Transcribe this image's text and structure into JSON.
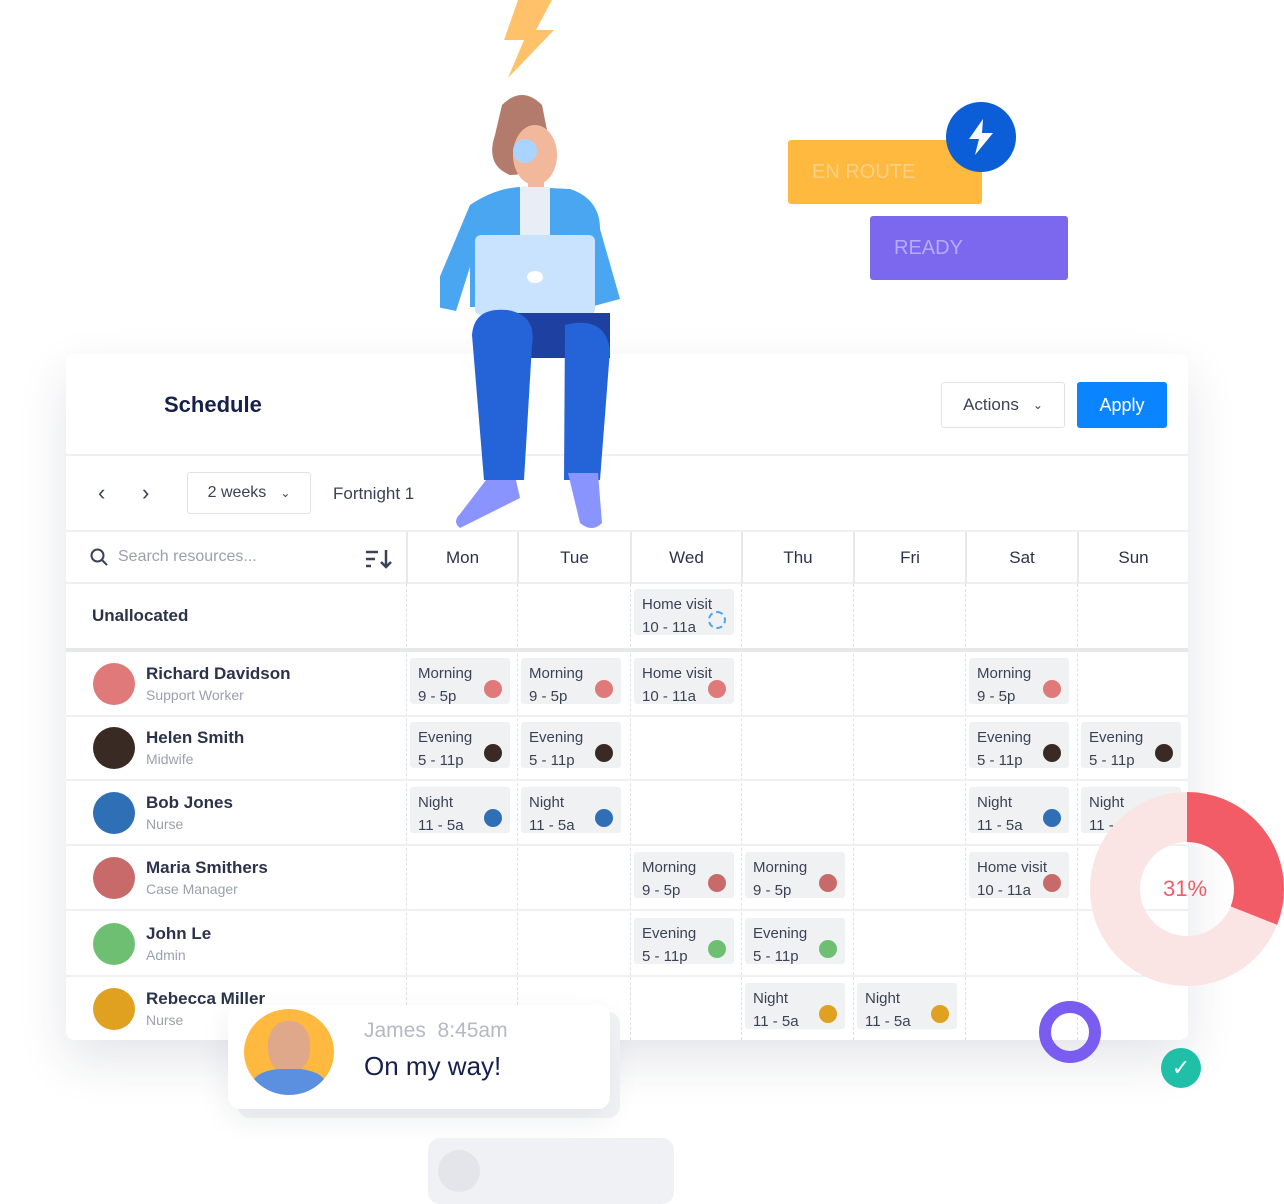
{
  "badges": {
    "en_route": "EN ROUTE",
    "ready": "READY",
    "en_route_color": "#ffb93e",
    "ready_color": "#7b68ee",
    "bolt_color": "#0b5ed7"
  },
  "header": {
    "title": "Schedule",
    "actions_label": "Actions",
    "apply_label": "Apply"
  },
  "toolbar": {
    "range": "2 weeks",
    "period": "Fortnight 1"
  },
  "search": {
    "placeholder": "Search resources..."
  },
  "days": [
    "Mon",
    "Tue",
    "Wed",
    "Thu",
    "Fri",
    "Sat",
    "Sun"
  ],
  "unallocated": {
    "label": "Unallocated",
    "shifts": [
      {
        "day": 2,
        "name": "Home visit",
        "time": "10 - 11a"
      }
    ]
  },
  "resources": [
    {
      "name": "Richard Davidson",
      "role": "Support Worker",
      "color": "#e07a7a",
      "shifts": [
        {
          "day": 0,
          "name": "Morning",
          "time": "9 - 5p"
        },
        {
          "day": 1,
          "name": "Morning",
          "time": "9 - 5p"
        },
        {
          "day": 2,
          "name": "Home visit",
          "time": "10 - 11a"
        },
        {
          "day": 5,
          "name": "Morning",
          "time": "9 - 5p"
        }
      ]
    },
    {
      "name": "Helen Smith",
      "role": "Midwife",
      "color": "#3a2a24",
      "shifts": [
        {
          "day": 0,
          "name": "Evening",
          "time": "5 - 11p"
        },
        {
          "day": 1,
          "name": "Evening",
          "time": "5 - 11p"
        },
        {
          "day": 5,
          "name": "Evening",
          "time": "5 - 11p"
        },
        {
          "day": 6,
          "name": "Evening",
          "time": "5 - 11p"
        }
      ]
    },
    {
      "name": "Bob Jones",
      "role": "Nurse",
      "color": "#2f6fb5",
      "shifts": [
        {
          "day": 0,
          "name": "Night",
          "time": "11 - 5a"
        },
        {
          "day": 1,
          "name": "Night",
          "time": "11 - 5a"
        },
        {
          "day": 5,
          "name": "Night",
          "time": "11 - 5a"
        },
        {
          "day": 6,
          "name": "Night",
          "time": "11 - 5a"
        }
      ]
    },
    {
      "name": "Maria Smithers",
      "role": "Case Manager",
      "color": "#c86a6a",
      "shifts": [
        {
          "day": 2,
          "name": "Morning",
          "time": "9 - 5p"
        },
        {
          "day": 3,
          "name": "Morning",
          "time": "9 - 5p"
        },
        {
          "day": 5,
          "name": "Home visit",
          "time": "10 - 11a"
        }
      ]
    },
    {
      "name": "John Le",
      "role": "Admin",
      "color": "#6fbf73",
      "shifts": [
        {
          "day": 2,
          "name": "Evening",
          "time": "5 - 11p"
        },
        {
          "day": 3,
          "name": "Evening",
          "time": "5 - 11p"
        }
      ]
    },
    {
      "name": "Rebecca Miller",
      "role": "Nurse",
      "color": "#e0a020",
      "shifts": [
        {
          "day": 3,
          "name": "Night",
          "time": "11 - 5a"
        },
        {
          "day": 4,
          "name": "Night",
          "time": "11 - 5a"
        }
      ]
    }
  ],
  "chat": {
    "sender": "James",
    "time": "8:45am",
    "message": "On my way!"
  },
  "donut": {
    "percent": 31,
    "label": "31%",
    "color": "#f25c66"
  }
}
